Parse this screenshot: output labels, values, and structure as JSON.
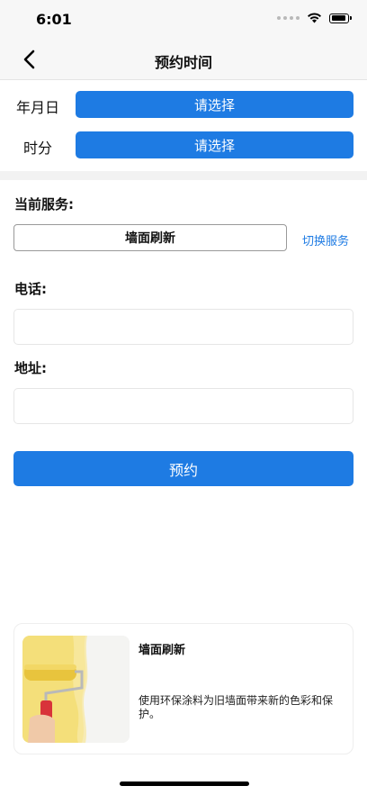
{
  "status_bar": {
    "time": "6:01"
  },
  "nav": {
    "title": "预约时间",
    "back_icon": "chevron-left-icon"
  },
  "pickers": {
    "date": {
      "label": "年月日",
      "button_label": "请选择"
    },
    "time": {
      "label": "时分",
      "button_label": "请选择"
    }
  },
  "service": {
    "label": "当前服务:",
    "current": "墙面刷新",
    "switch_label": "切换服务"
  },
  "phone": {
    "label": "电话:",
    "value": "",
    "placeholder": ""
  },
  "address": {
    "label": "地址:",
    "value": "",
    "placeholder": ""
  },
  "submit_label": "预约",
  "card": {
    "title": "墙面刷新",
    "description": "使用环保涂料为旧墙面带来新的色彩和保护。",
    "image_icon": "paint-roller-image"
  },
  "colors": {
    "accent": "#1e7be3",
    "nav_background": "#f7f7f7"
  }
}
